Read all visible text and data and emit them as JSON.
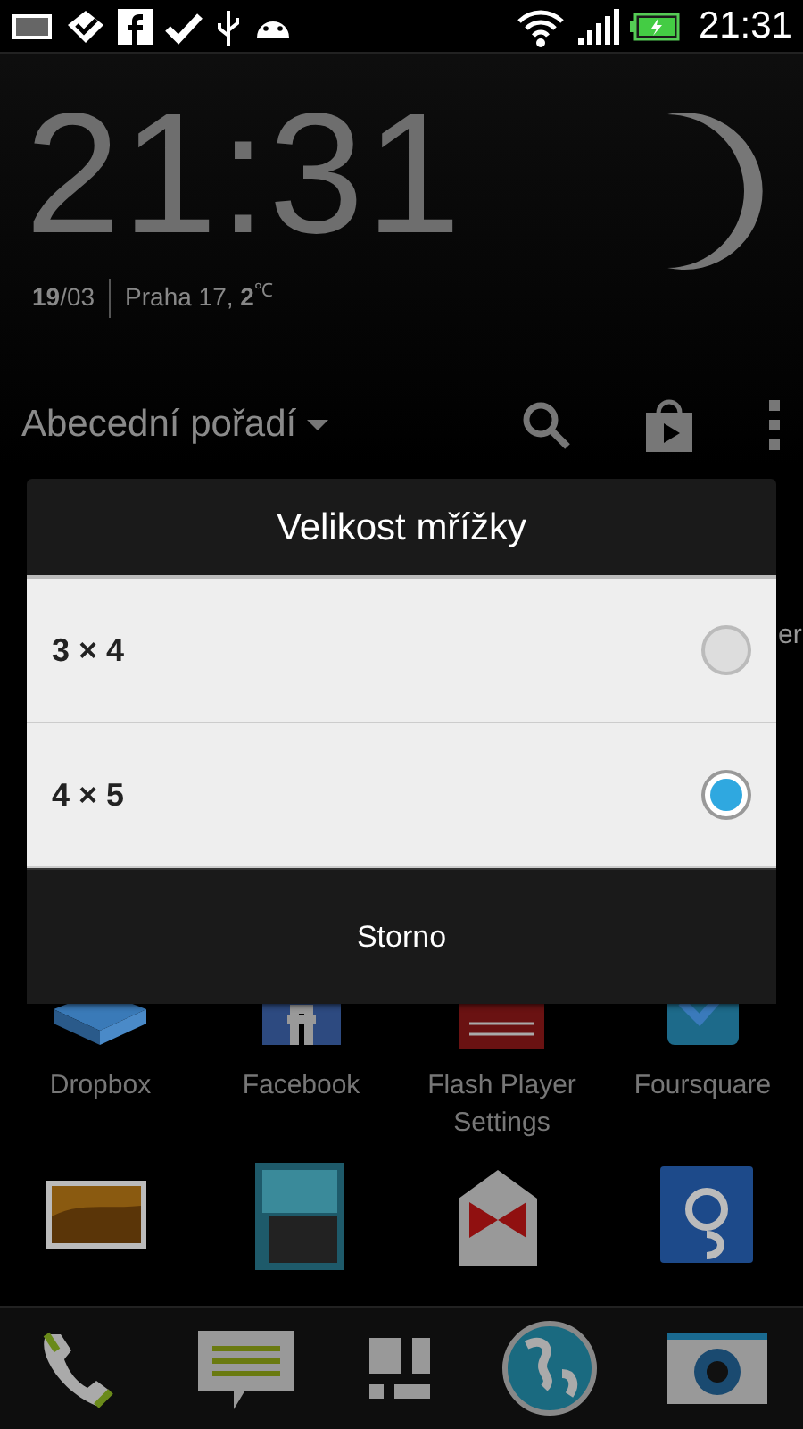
{
  "status_bar": {
    "time": "21:31"
  },
  "clock": {
    "time": "21:31",
    "date": "**19**/03",
    "weather": "Praha 17, **2**$^{℃}$"
  },
  "action_bar": {
    "sort_label": "Abecední pořadí"
  },
  "hidden_label_fragment": "er",
  "apps": [
    {
      "label": "Dropbox"
    },
    {
      "label": "Facebook"
    },
    {
      "label": "Flash Player Settings"
    },
    {
      "label": "Foursquare"
    }
  ],
  "dialog": {
    "title": "Velikost mřížky",
    "options": [
      {
        "label": "3 × 4",
        "selected": false
      },
      {
        "label": "4 × 5",
        "selected": true
      }
    ],
    "cancel": "Storno"
  }
}
